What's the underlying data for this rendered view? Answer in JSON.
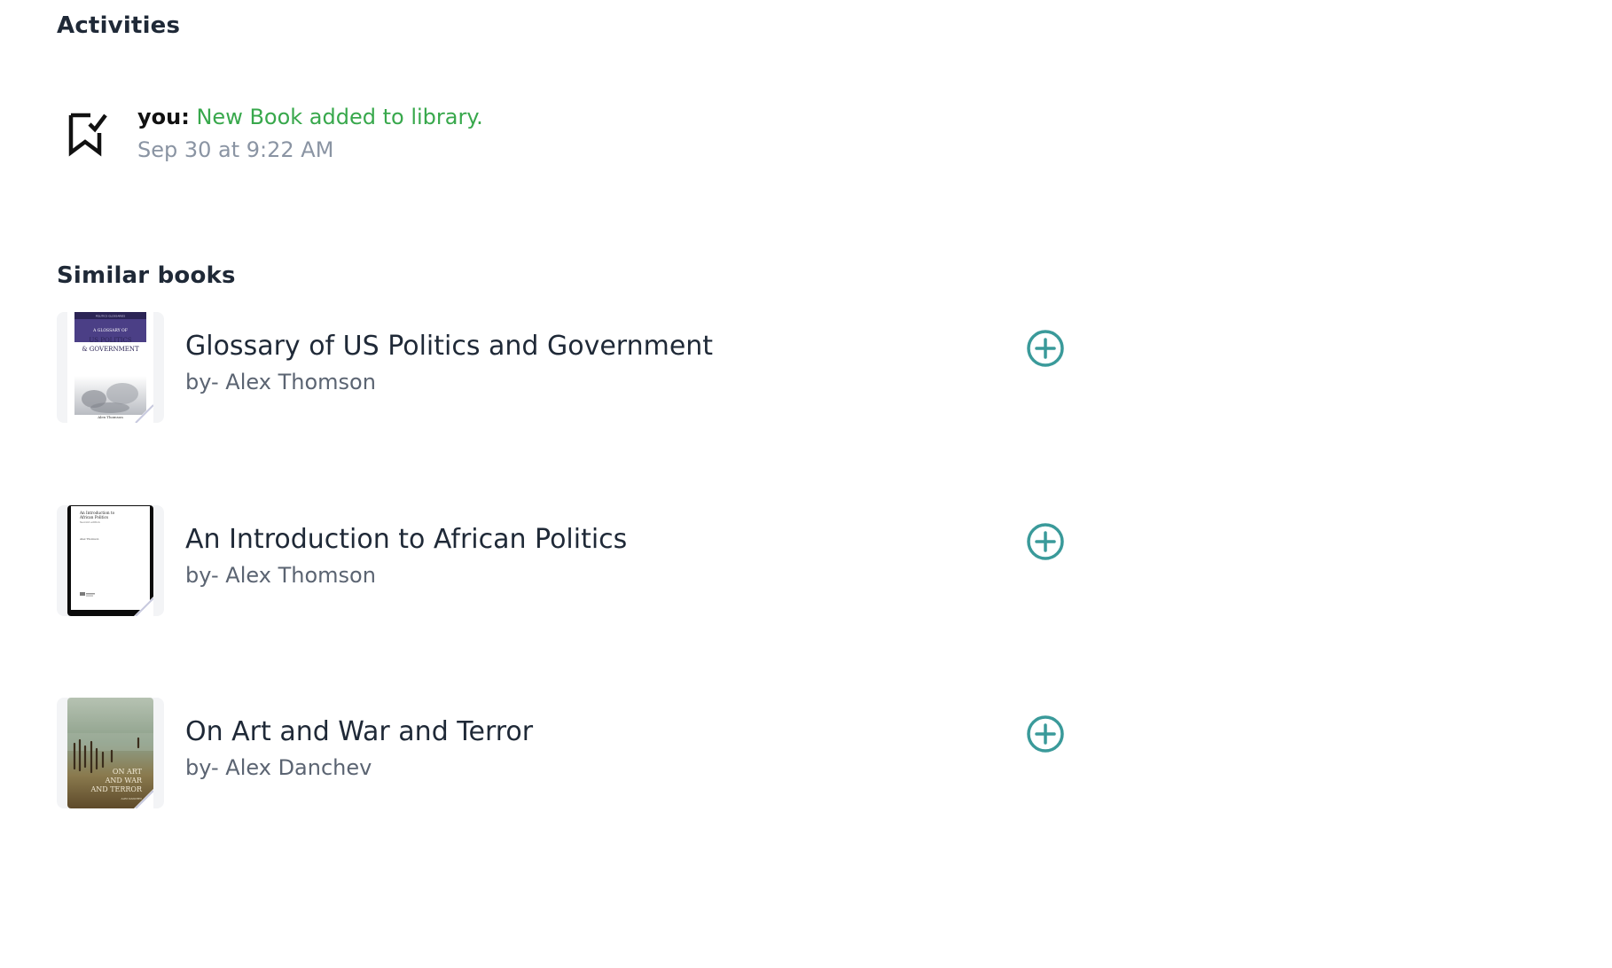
{
  "activities": {
    "heading": "Activities",
    "items": [
      {
        "icon": "bookmark-check-icon",
        "actor": "you:",
        "message": "New Book added to library.",
        "timestamp": "Sep 30 at 9:22 AM"
      }
    ]
  },
  "similar_books": {
    "heading": "Similar books",
    "items": [
      {
        "title": "Glossary of US Politics and Government",
        "author": "by- Alex Thomson",
        "cover_text": {
          "series": "POLITICS GLOSSARIES",
          "line1": "A GLOSSARY OF",
          "line2": "US POLITICS",
          "line3": "& GOVERNMENT",
          "author": "Alex Thomson"
        },
        "action_icon": "plus-circle-icon"
      },
      {
        "title": "An Introduction to African Politics",
        "author": "by- Alex Thomson",
        "cover_text": {
          "line1": "An Introduction to",
          "line2": "African Politics",
          "edition": "Second edition",
          "author": "Alex Thomson"
        },
        "action_icon": "plus-circle-icon"
      },
      {
        "title": "On Art and War and Terror",
        "author": "by- Alex Danchev",
        "cover_text": {
          "line1": "ON ART",
          "line2": "AND WAR",
          "line3": "AND TERROR",
          "author": "ALEX DANCHEV"
        },
        "action_icon": "plus-circle-icon"
      }
    ]
  },
  "colors": {
    "accent": "#3a9a9a",
    "activity_message": "#38a84c",
    "muted_text": "#8a94a3"
  }
}
